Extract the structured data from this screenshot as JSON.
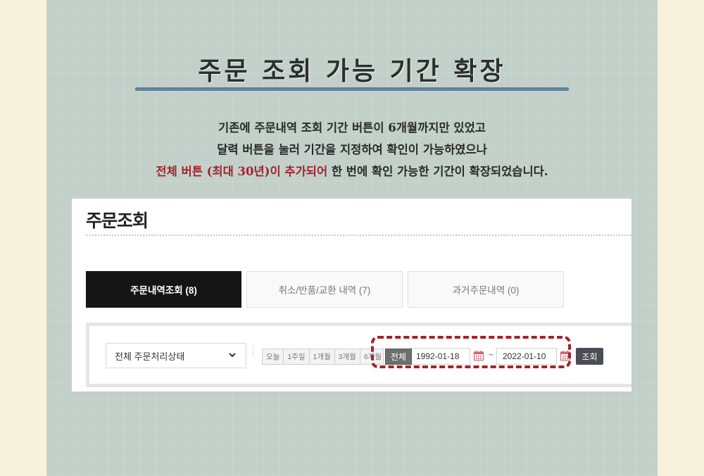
{
  "headline": "주문 조회 가능 기간 확장",
  "description": {
    "line1": "기존에 주문내역 조회 기간 버튼이 6개월까지만 있었고",
    "line2": "달력 버튼을 눌러 기간을 지정하여 확인이 가능하였으나",
    "line3_highlight": "전체 버튼 (최대 30년)이 추가되어",
    "line3_rest": " 한 번에 확인 가능한 기간이 확장되었습니다."
  },
  "colors": {
    "highlight": "#a3232b",
    "accent_bar": "#5f8296",
    "active_tab": "#151515"
  },
  "order_page": {
    "title": "주문조회",
    "tabs": [
      {
        "label": "주문내역조회 (8)",
        "active": true
      },
      {
        "label": "취소/반품/교환 내역 (7)",
        "active": false
      },
      {
        "label": "과거주문내역 (0)",
        "active": false
      }
    ],
    "status_select": {
      "value": "전체 주문처리상태",
      "icon": "chevron-down-icon"
    },
    "period_buttons": [
      "오늘",
      "1주일",
      "1개월",
      "3개월",
      "6개월"
    ],
    "all_button": "전체",
    "start_date": "1992-01-18",
    "end_date": "2022-01-10",
    "date_separator": "~",
    "calendar_icon": "calendar-icon",
    "search_button": "조회"
  }
}
